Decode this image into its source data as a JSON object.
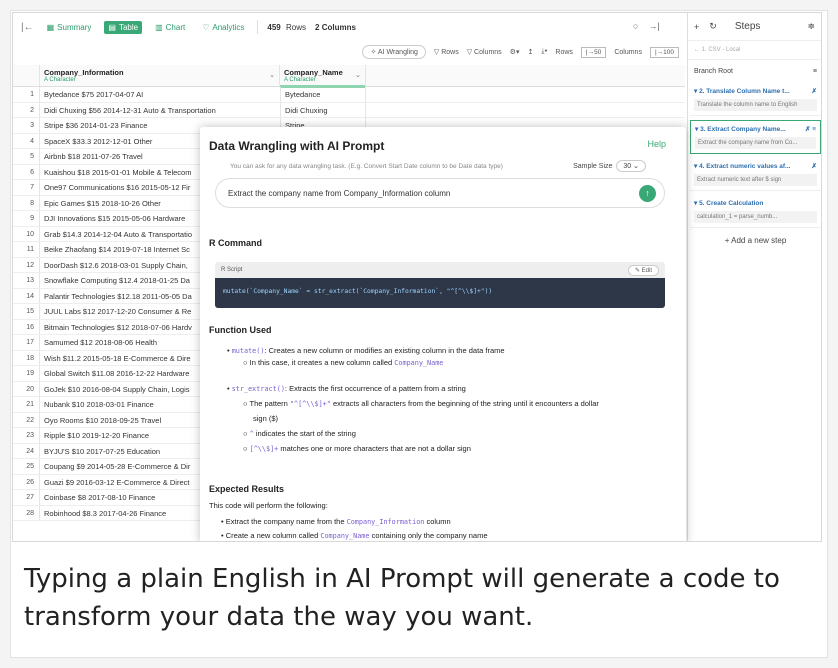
{
  "app": {
    "tabs": [
      {
        "label": "Summary",
        "icon": "summary-icon"
      },
      {
        "label": "Table",
        "icon": "table-icon"
      },
      {
        "label": "Chart",
        "icon": "chart-icon"
      },
      {
        "label": "Analytics",
        "icon": "analytics-icon"
      }
    ],
    "rows_count": "459",
    "rows_label": "Rows",
    "columns_info": "2 Columns"
  },
  "toolbar": {
    "ai_wrangling": "AI Wrangling",
    "rows_btn": "Rows",
    "columns_btn": "Columns",
    "rows_label": "Rows",
    "rows_value": "|→50",
    "columns_label": "Columns",
    "columns_value": "|→100"
  },
  "table": {
    "columns": [
      {
        "name": "Company_Information",
        "type": "Character"
      },
      {
        "name": "Company_Name",
        "type": "Character"
      }
    ],
    "rows": [
      [
        "1",
        "Bytedance $75 2017-04-07 AI",
        "Bytedance"
      ],
      [
        "2",
        "Didi Chuxing $56 2014-12-31 Auto & Transportation",
        "Didi Chuxing"
      ],
      [
        "3",
        "Stripe $36 2014-01-23 Finance",
        "Stripe"
      ],
      [
        "4",
        "SpaceX $33.3 2012-12-01 Other",
        ""
      ],
      [
        "5",
        "Airbnb $18 2011-07-26 Travel",
        ""
      ],
      [
        "6",
        "Kuaishou $18 2015-01-01 Mobile & Telecom",
        ""
      ],
      [
        "7",
        "One97 Communications $16 2015-05-12 Fir",
        ""
      ],
      [
        "8",
        "Epic Games $15 2018-10-26 Other",
        ""
      ],
      [
        "9",
        "DJI Innovations $15 2015-05-06 Hardware",
        ""
      ],
      [
        "10",
        "Grab $14.3 2014-12-04 Auto & Transportatio",
        ""
      ],
      [
        "11",
        "Beike Zhaofang $14 2019-07-18 Internet Sc",
        ""
      ],
      [
        "12",
        "DoorDash $12.6 2018-03-01 Supply Chain,",
        ""
      ],
      [
        "13",
        "Snowflake Computing $12.4 2018-01-25 Da",
        ""
      ],
      [
        "14",
        "Palantir Technologies $12.18 2011-05-05 Da",
        ""
      ],
      [
        "15",
        "JUUL Labs $12 2017-12-20 Consumer & Re",
        ""
      ],
      [
        "16",
        "Bitmain Technologies $12 2018-07-06 Hardv",
        ""
      ],
      [
        "17",
        "Samumed $12 2018-08-06 Health",
        ""
      ],
      [
        "18",
        "Wish $11.2 2015-05-18 E-Commerce & Dire",
        ""
      ],
      [
        "19",
        "Global Switch $11.08 2016-12-22 Hardware",
        ""
      ],
      [
        "20",
        "GoJek $10 2016-08-04 Supply Chain, Logis",
        ""
      ],
      [
        "21",
        "Nubank $10 2018-03-01 Finance",
        ""
      ],
      [
        "22",
        "Oyo Rooms $10 2018-09-25 Travel",
        ""
      ],
      [
        "23",
        "Ripple $10 2019-12-20 Finance",
        ""
      ],
      [
        "24",
        "BYJU'S $10 2017-07-25 Education",
        ""
      ],
      [
        "25",
        "Coupang $9 2014-05-28 E-Commerce & Dir",
        ""
      ],
      [
        "26",
        "Guazi $9 2016-03-12 E-Commerce & Direct",
        ""
      ],
      [
        "27",
        "Coinbase $8 2017-08-10 Finance",
        ""
      ],
      [
        "28",
        "Robinhood $8.3 2017-04-26 Finance",
        ""
      ]
    ]
  },
  "steps": {
    "title": "Steps",
    "source": "← 1. CSV - Local",
    "branch": "Branch Root",
    "items": [
      {
        "title": "▾ 2. Translate Column Name t...",
        "desc": "Translate the column name to English"
      },
      {
        "title": "▾ 3. Extract Company Name...",
        "desc": "Extract the company name from Co..."
      },
      {
        "title": "▾ 4. Extract numeric values af...",
        "desc": "Extract numeric text after $ sign"
      },
      {
        "title": "▾ 5. Create Calculation",
        "desc": "calculation_1 = parse_numb..."
      }
    ],
    "add_step": "+ Add a new step"
  },
  "modal": {
    "title": "Data Wrangling with AI Prompt",
    "help": "Help",
    "hint": "You can ask for any data wrangling task. (E.g. Convert Start Date column to be Date data type)",
    "sample_label": "Sample Size",
    "sample_value": "30",
    "prompt": "Extract the company name from Company_Information column",
    "r_command": "R Command",
    "r_script_label": "R Script",
    "edit": "Edit",
    "code": "mutate(`Company_Name` = str_extract(`Company_Information`, \"^[^\\\\$]+\"))",
    "function_used": "Function Used",
    "fn1_name": "mutate()",
    "fn1_desc": ": Creates a new column or modifies an existing column in the data frame",
    "fn1_sub_pre": "In this case, it creates a new column called",
    "fn1_sub_code": "Company_Name",
    "fn2_name": "str_extract()",
    "fn2_desc": ": Extracts the first occurrence of a pattern from a string",
    "fn2_sub1_pre": "The pattern",
    "fn2_sub1_code": "\"^[^\\\\$]+\"",
    "fn2_sub1_post": "extracts all characters from the beginning of the string until it encounters a dollar",
    "fn2_sub1_cont": "sign ($)",
    "fn2_sub2_code": "^",
    "fn2_sub2_post": "indicates the start of the string",
    "fn2_sub3_code": "[^\\\\$]+",
    "fn2_sub3_post": "matches one or more characters that are not a dollar sign",
    "expected": "Expected Results",
    "expected_intro": "This code will perform the following:",
    "exp1_pre": "Extract the company name from the",
    "exp1_code": "Company_Information",
    "exp1_post": "column",
    "exp2_pre": "Create a new column called",
    "exp2_code": "Company_Name",
    "exp2_post": "containing only the company name"
  },
  "caption": "Typing a plain English in AI Prompt will generate a code to transform your data the way you want.",
  "colors": {
    "accent": "#3aa876",
    "link": "#2d6fb0",
    "code_bg": "#2d3748"
  }
}
